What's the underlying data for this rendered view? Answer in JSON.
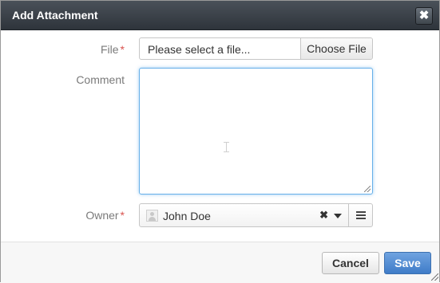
{
  "dialog": {
    "title": "Add Attachment",
    "close_symbol": "✖"
  },
  "form": {
    "file": {
      "label": "File",
      "required_marker": "*",
      "placeholder": "Please select a file...",
      "button_label": "Choose File"
    },
    "comment": {
      "label": "Comment",
      "value": ""
    },
    "owner": {
      "label": "Owner",
      "required_marker": "*",
      "value": "John Doe",
      "clear_symbol": "✖"
    }
  },
  "footer": {
    "cancel_label": "Cancel",
    "save_label": "Save"
  },
  "icons": {
    "close": "close-icon",
    "avatar": "user-avatar-icon",
    "clear": "clear-icon",
    "dropdown": "chevron-down-icon",
    "menu": "hamburger-menu-icon",
    "resize": "resize-grip-icon"
  },
  "colors": {
    "titlebar": "#3a4047",
    "primary": "#4a86d0",
    "required": "#d9534f",
    "focus": "#66afe9"
  }
}
